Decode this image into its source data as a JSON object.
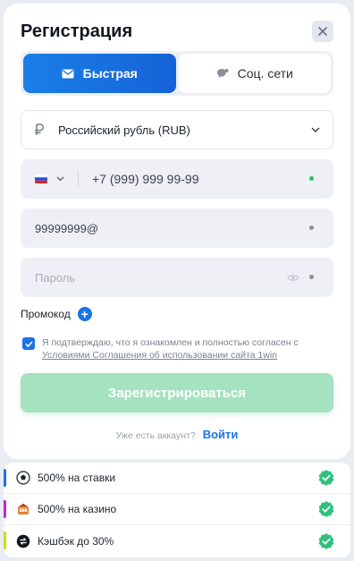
{
  "modal": {
    "title": "Регистрация",
    "close_icon": "close-icon"
  },
  "tabs": [
    {
      "label": "Быстрая",
      "icon": "mail-icon",
      "active": true
    },
    {
      "label": "Соц. сети",
      "icon": "chat-icon",
      "active": false
    }
  ],
  "currency": {
    "icon": "ruble-icon",
    "value": "Российский рубль (RUB)"
  },
  "phone": {
    "country_flag": "flag-ru-icon",
    "value": "+7 (999) 999 99-99",
    "status_color": "#22c55e"
  },
  "email": {
    "value": "99999999@"
  },
  "password": {
    "placeholder": "Пароль"
  },
  "promo": {
    "label": "Промокод",
    "button": "+"
  },
  "consent": {
    "checked": true,
    "text": "Я подтверждаю, что я ознакомлен и полностью согласен с",
    "link": "Условиями Соглашения об использовании сайта 1win"
  },
  "submit": {
    "label": "Зарегистрироваться"
  },
  "login": {
    "question": "Уже есть аккаунт?",
    "link": "Войти"
  },
  "bonuses": [
    {
      "label": "500% на ставки",
      "icon": "soccer-ball-icon",
      "bar_color": "#1a73e8"
    },
    {
      "label": "500% на казино",
      "icon": "casino-icon",
      "bar_color": "#c026d3"
    },
    {
      "label": "Кэшбэк до 30%",
      "icon": "cashback-icon",
      "bar_color": "#c6e000"
    }
  ],
  "colors": {
    "accent": "#1a73e8",
    "success": "#2ec27e"
  }
}
